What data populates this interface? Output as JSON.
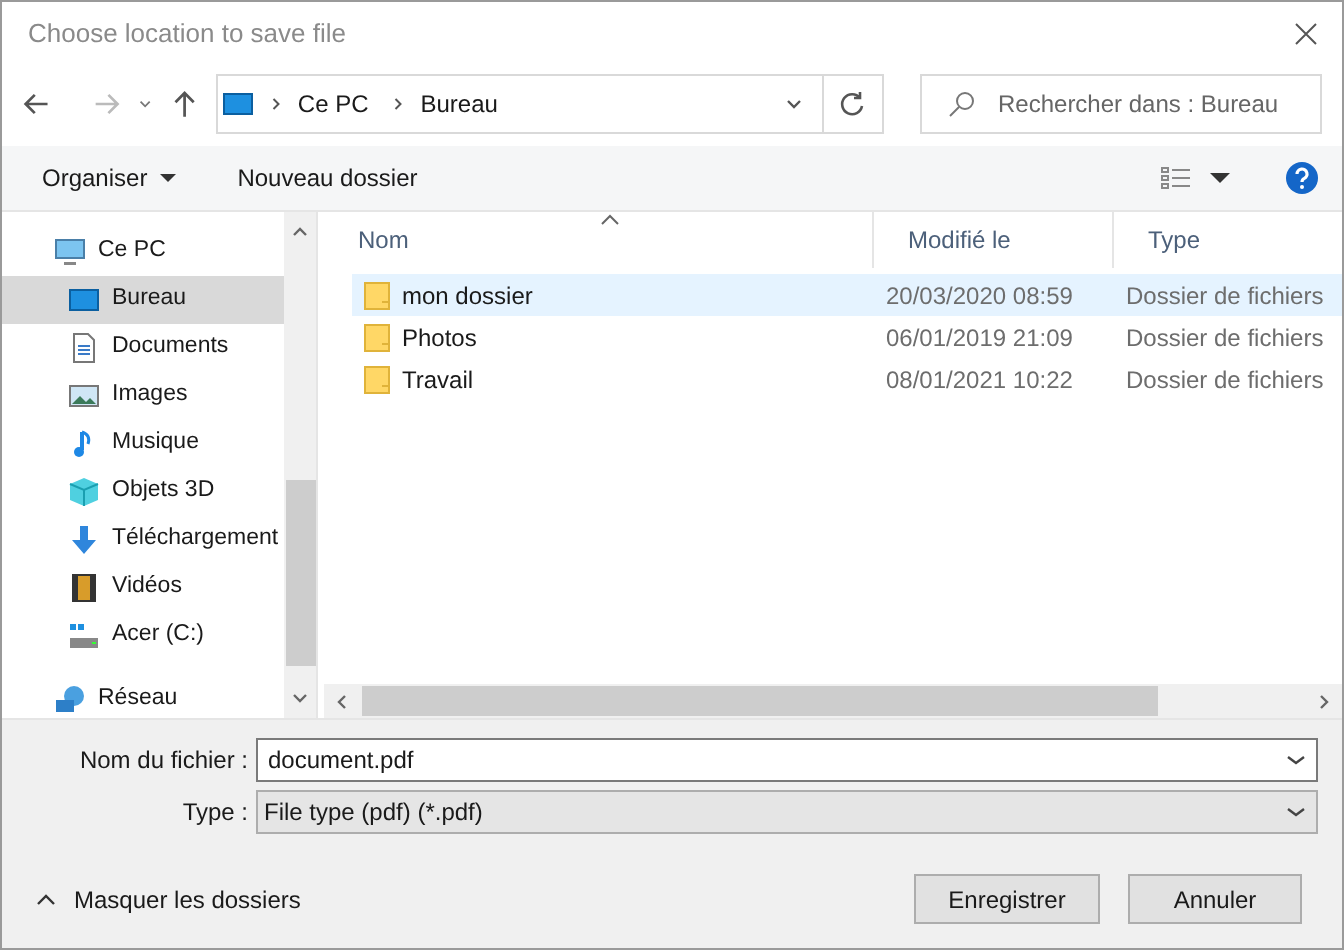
{
  "window": {
    "title": "Choose location to save file"
  },
  "address": {
    "segments": [
      "Ce PC",
      "Bureau"
    ]
  },
  "search": {
    "placeholder": "Rechercher dans : Bureau"
  },
  "toolbar": {
    "organize": "Organiser",
    "new_folder": "Nouveau dossier"
  },
  "sidebar": {
    "items": [
      {
        "label": "Ce PC",
        "selected": false,
        "children": [
          {
            "label": "Bureau",
            "selected": true
          },
          {
            "label": "Documents",
            "selected": false
          },
          {
            "label": "Images",
            "selected": false
          },
          {
            "label": "Musique",
            "selected": false
          },
          {
            "label": "Objets 3D",
            "selected": false
          },
          {
            "label": "Téléchargement",
            "selected": false
          },
          {
            "label": "Vidéos",
            "selected": false
          },
          {
            "label": "Acer (C:)",
            "selected": false
          }
        ]
      },
      {
        "label": "Réseau",
        "selected": false
      }
    ]
  },
  "table": {
    "columns": [
      "Nom",
      "Modifié le",
      "Type"
    ],
    "rows": [
      {
        "name": "mon dossier",
        "modified": "20/03/2020 08:59",
        "type": "Dossier de fichiers",
        "selected": true
      },
      {
        "name": "Photos",
        "modified": "06/01/2019 21:09",
        "type": "Dossier de fichiers",
        "selected": false
      },
      {
        "name": "Travail",
        "modified": "08/01/2021 10:22",
        "type": "Dossier de fichiers",
        "selected": false
      }
    ]
  },
  "filename": {
    "label": "Nom du fichier :",
    "value": "document.pdf"
  },
  "filetype": {
    "label": "Type :",
    "value": "File type (pdf) (*.pdf)"
  },
  "hide_folders": "Masquer les dossiers",
  "buttons": {
    "save": "Enregistrer",
    "cancel": "Annuler"
  }
}
